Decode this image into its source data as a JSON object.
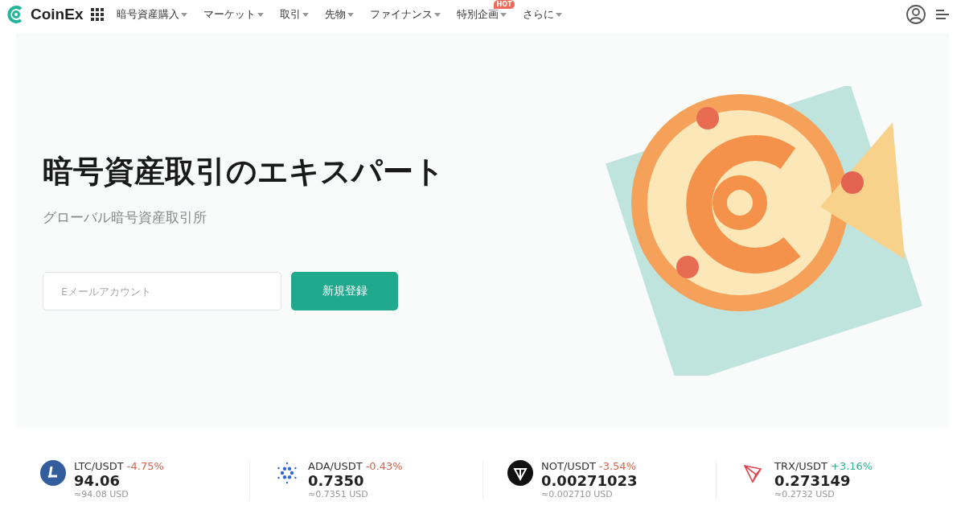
{
  "header": {
    "logo": "CoinEx",
    "nav": [
      {
        "label": "暗号資産購入"
      },
      {
        "label": "マーケット"
      },
      {
        "label": "取引"
      },
      {
        "label": "先物"
      },
      {
        "label": "ファイナンス"
      },
      {
        "label": "特別企画",
        "badge": "HOT"
      },
      {
        "label": "さらに"
      }
    ]
  },
  "hero": {
    "title": "暗号資産取引のエキスパート",
    "subtitle": "グローバル暗号資産取引所",
    "email": {
      "placeholder": "Eメールアカウント"
    },
    "signup_button": "新規登録"
  },
  "tickers": [
    {
      "pair": "LTC/USDT",
      "change": "-4.75%",
      "color": "#d0644c",
      "price": "94.06",
      "usd": "≈94.08 USD"
    },
    {
      "pair": "ADA/USDT",
      "change": "-0.43%",
      "color": "#d0644c",
      "price": "0.7350",
      "usd": "≈0.7351 USD"
    },
    {
      "pair": "NOT/USDT",
      "change": "-3.54%",
      "color": "#d0644c",
      "price": "0.00271023",
      "usd": "≈0.002710 USD"
    },
    {
      "pair": "TRX/USDT",
      "change": "+3.16%",
      "color": "#2fb38a",
      "price": "0.273149",
      "usd": "≈0.2732 USD"
    }
  ]
}
